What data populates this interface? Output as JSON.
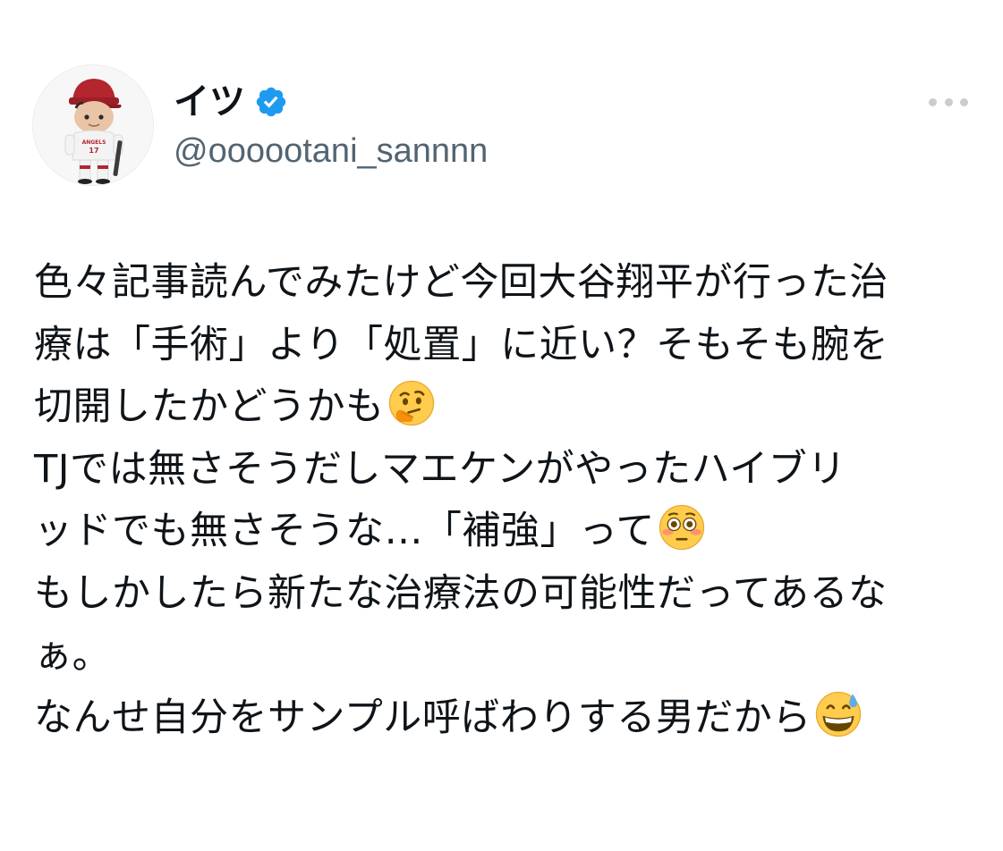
{
  "tweet": {
    "display_name": "イツ",
    "handle": "@oooootani_sannnn",
    "verified_icon": "verified-badge-icon",
    "more_icon": "more-options-icon",
    "avatar_icon": "baseball-player-figure-avatar",
    "lines": [
      "色々記事読んでみたけど今回大谷翔平が行った治",
      "療は「手術」より「処置」に近い？そもそも腕を",
      "切開したかどうかも",
      "TJでは無さそうだしマエケンがやったハイブリ",
      "ッドでも無さそうな…「補強」って",
      "もしかしたら新たな治療法の可能性だってあるな",
      "ぁ。",
      "なんせ自分をサンプル呼ばわりする男だから"
    ],
    "emojis": {
      "thinking": "thinking-face-emoji",
      "flushed": "flushed-face-emoji",
      "sweat_smile": "grinning-sweat-face-emoji"
    },
    "colors": {
      "text": "#0f1419",
      "secondary": "#536471",
      "verified_blue": "#1d9bf0",
      "dots": "#c9ccd0"
    }
  }
}
